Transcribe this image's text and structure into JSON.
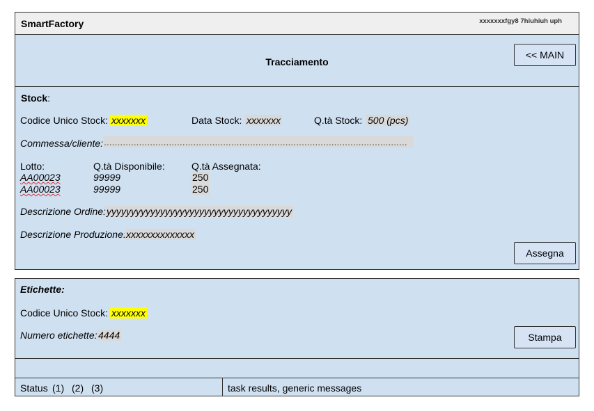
{
  "app": {
    "title": "SmartFactory",
    "user_info": "xxxxxxxfgy8 7hiuhiuh uph"
  },
  "header": {
    "title": "Tracciamento",
    "main_button": "<< MAIN"
  },
  "stock": {
    "heading": "Stock",
    "heading_suffix": ":",
    "codice_label": "Codice Unico Stock:",
    "codice_value": "xxxxxxx",
    "data_label": "Data Stock:",
    "data_value": "xxxxxxx",
    "qta_label": "Q.tà Stock:",
    "qta_value": "500 (pcs)",
    "commessa_label": "Commessa/cliente:",
    "commessa_value": "................................................................................................................",
    "columns": {
      "lotto": "Lotto:",
      "disponibile": "Q.tà Disponibile:",
      "assegnata": "Q.tà Assegnata:"
    },
    "rows": [
      {
        "lotto": "AA00023",
        "disponibile": "99999",
        "assegnata": "250"
      },
      {
        "lotto": "AA00023",
        "disponibile": "99999",
        "assegnata": "250"
      }
    ],
    "descr_ordine_label": "Descrizione Ordine:",
    "descr_ordine_value": "yyyyyyyyyyyyyyyyyyyyyyyyyyyyyyyyyyyyyy",
    "descr_prod_label": "Descrizione Produzione:",
    "descr_prod_value": "xxxxxxxxxxxxxx",
    "assign_button": "Assegna"
  },
  "etichette": {
    "heading": "Etichette:",
    "codice_label": "Codice Unico Stock:",
    "codice_value": "xxxxxxx",
    "numero_label": "Numero etichette:",
    "numero_value": "4444",
    "print_button": "Stampa"
  },
  "status": {
    "label": "Status",
    "item1": "(1)",
    "item2": "(2)",
    "item3": "(3)",
    "message": "task results, generic messages"
  }
}
